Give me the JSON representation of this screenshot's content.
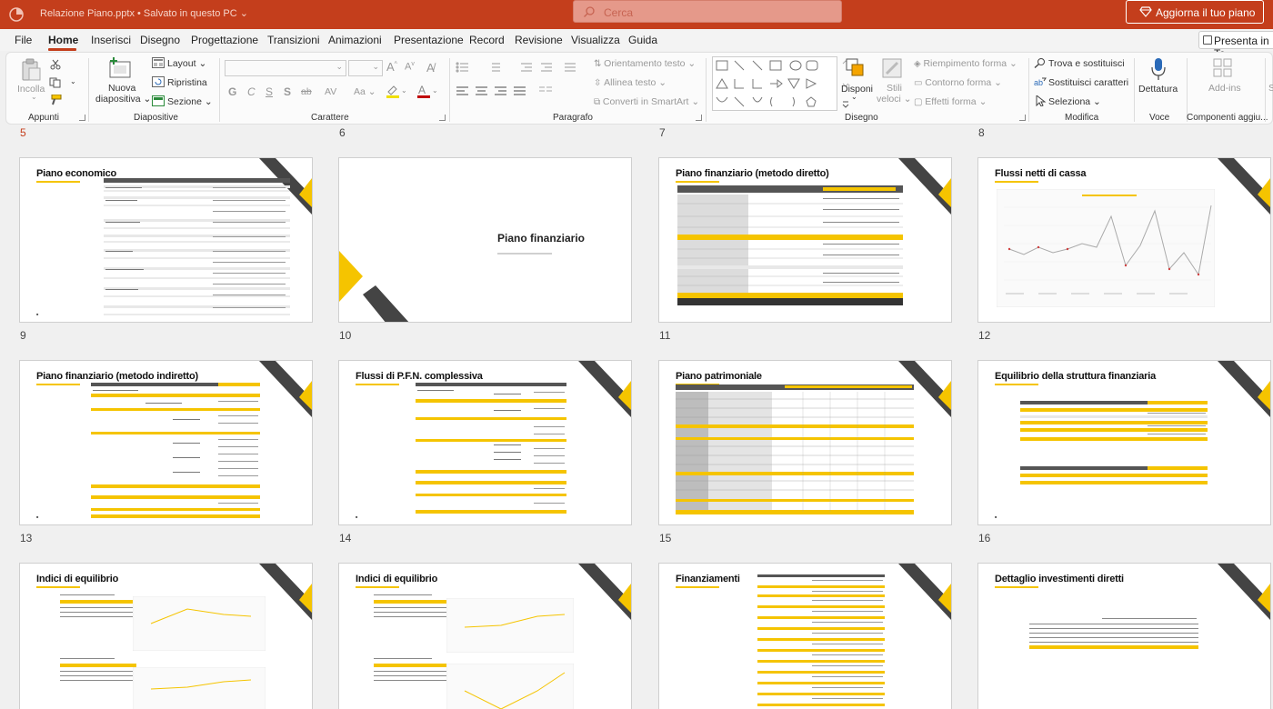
{
  "titlebar": {
    "doc_title": "Relazione Piano.pptx • Salvato in questo PC ⌄",
    "search_placeholder": "Cerca",
    "upgrade_label": "Aggiorna il tuo piano",
    "bg_color": "#c43e1c"
  },
  "menu": {
    "tabs": [
      "File",
      "Home",
      "Inserisci",
      "Disegno",
      "Progettazione",
      "Transizioni",
      "Animazioni",
      "Presentazione",
      "Record",
      "Revisione",
      "Visualizza",
      "Guida"
    ],
    "active_tab": "Home",
    "present_label": "Presenta in Te"
  },
  "ribbon": {
    "appunti": {
      "paste": "Incolla",
      "label": "Appunti"
    },
    "diapositive": {
      "new_slide_1": "Nuova",
      "new_slide_2": "diapositiva ⌄",
      "layout": "Layout ⌄",
      "ripristina": "Ripristina",
      "sezione": "Sezione ⌄",
      "label": "Diapositive"
    },
    "carattere": {
      "label": "Carattere",
      "bold": "G",
      "italic": "C",
      "underline": "S",
      "shadow": "S",
      "strike": "ab",
      "spacing": "AV",
      "case": "Aa ⌄"
    },
    "paragrafo": {
      "label": "Paragrafo",
      "orient": "Orientamento testo ⌄",
      "align": "Allinea testo ⌄",
      "smartart": "Converti in SmartArt ⌄"
    },
    "disegno": {
      "label": "Disegno",
      "arrange": "Disponi",
      "styles_1": "Stili",
      "styles_2": "veloci ⌄",
      "fill": "Riempimento forma ⌄",
      "outline": "Contorno forma ⌄",
      "effects": "Effetti forma ⌄"
    },
    "modifica": {
      "label": "Modifica",
      "find": "Trova e sostituisci",
      "replace": "Sostituisci caratteri",
      "select": "Seleziona ⌄"
    },
    "voce": {
      "dictate": "Dettatura",
      "label": "Voce"
    },
    "addins": {
      "addins": "Add-ins",
      "label": "Componenti aggiu..."
    }
  },
  "slides": [
    {
      "number": "5",
      "title": ""
    },
    {
      "number": "6",
      "title": ""
    },
    {
      "number": "7",
      "title": ""
    },
    {
      "number": "8",
      "title": ""
    },
    {
      "number": "9",
      "title": "Piano economico"
    },
    {
      "number": "10",
      "title": "Piano finanziario"
    },
    {
      "number": "11",
      "title": "Piano finanziario (metodo diretto)"
    },
    {
      "number": "12",
      "title": "Flussi netti di cassa"
    },
    {
      "number": "13",
      "title": "Piano finanziario (metodo indiretto)"
    },
    {
      "number": "14",
      "title": "Flussi di P.F.N. complessiva"
    },
    {
      "number": "15",
      "title": "Piano patrimoniale"
    },
    {
      "number": "16",
      "title": "Equilibrio della struttura finanziaria"
    },
    {
      "number": "",
      "title": "Indici di equilibrio"
    },
    {
      "number": "",
      "title": "Indici di equilibrio"
    },
    {
      "number": "",
      "title": "Finanziamenti"
    },
    {
      "number": "",
      "title": "Dettaglio investimenti diretti"
    }
  ],
  "colors": {
    "accent": "#c43e1c",
    "slide_yellow": "#f5c400",
    "slide_dark": "#444444"
  }
}
